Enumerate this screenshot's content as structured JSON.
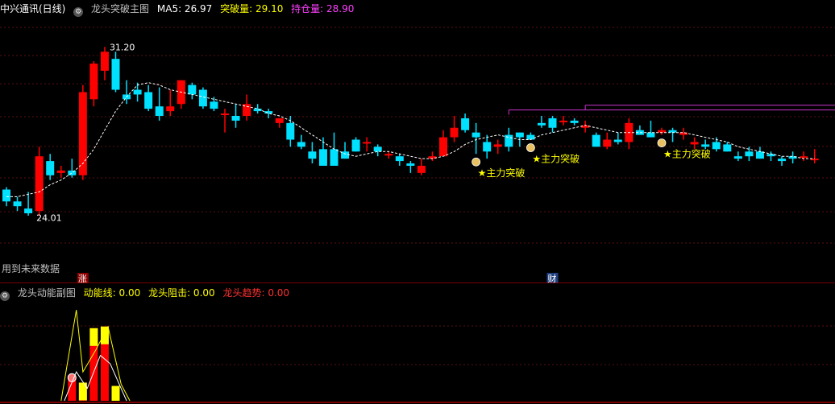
{
  "header": {
    "stock_name": "中兴通讯(日线)",
    "indicator_name": "龙头突破主图",
    "ma5_label": "MA5: 26.97",
    "breakthrough_label": "突破量: 29.10",
    "holding_label": "持仓量: 28.90"
  },
  "sub_header": {
    "indicator_name": "龙头动能副图",
    "momentum_label": "动能线: 0.00",
    "resistance_label": "龙头阻击: 0.00",
    "trend_label": "龙头趋势: 0.00"
  },
  "chart_labels": {
    "high_price": "31.20",
    "low_price": "24.01",
    "future_data_note": "用到未来数据",
    "limit_up_tag": "涨",
    "finance_tag": "财",
    "signal_text": "★主力突破"
  },
  "colors": {
    "up": "#ff0000",
    "down": "#00e0ff",
    "ma": "#ffffff",
    "stock_name": "#ffffff",
    "indicator": "#ffff00",
    "holding": "#ff40ff",
    "subtrend": "#ff3030",
    "separator": "#a00000"
  },
  "chart_data": {
    "type": "candlestick",
    "ylim": [
      22.0,
      32.5
    ],
    "high_label": 31.2,
    "low_label": 24.01,
    "ohlc": [
      [
        25.2,
        25.3,
        24.5,
        24.7
      ],
      [
        24.7,
        24.9,
        24.3,
        24.5
      ],
      [
        24.4,
        25.1,
        24.1,
        24.2
      ],
      [
        24.3,
        27.0,
        24.1,
        26.6
      ],
      [
        26.4,
        26.7,
        25.6,
        25.8
      ],
      [
        25.9,
        26.2,
        25.7,
        26.0
      ],
      [
        26.0,
        26.5,
        25.7,
        25.8
      ],
      [
        25.8,
        29.6,
        25.6,
        29.3
      ],
      [
        29.0,
        30.6,
        28.7,
        30.5
      ],
      [
        30.2,
        31.2,
        29.8,
        31.0
      ],
      [
        30.7,
        31.0,
        29.3,
        29.4
      ],
      [
        29.2,
        29.8,
        28.8,
        29.0
      ],
      [
        29.4,
        29.7,
        28.9,
        29.2
      ],
      [
        29.3,
        29.6,
        28.5,
        28.6
      ],
      [
        28.7,
        29.5,
        28.1,
        28.3
      ],
      [
        28.5,
        29.4,
        28.3,
        28.7
      ],
      [
        28.8,
        29.8,
        28.6,
        29.8
      ],
      [
        29.6,
        29.7,
        29.0,
        29.2
      ],
      [
        29.4,
        29.5,
        28.6,
        28.7
      ],
      [
        28.9,
        29.1,
        28.5,
        28.6
      ],
      [
        28.4,
        28.6,
        27.6,
        28.4
      ],
      [
        28.3,
        28.8,
        27.8,
        28.1
      ],
      [
        28.3,
        29.2,
        28.1,
        28.8
      ],
      [
        28.6,
        28.8,
        28.4,
        28.5
      ],
      [
        28.5,
        28.6,
        28.2,
        28.4
      ],
      [
        28.0,
        28.2,
        27.8,
        28.2
      ],
      [
        28.0,
        28.3,
        27.0,
        27.3
      ],
      [
        27.2,
        27.5,
        26.9,
        27.0
      ],
      [
        26.8,
        27.2,
        26.3,
        26.5
      ],
      [
        26.9,
        27.4,
        26.8,
        26.2
      ],
      [
        26.9,
        27.6,
        26.2,
        26.2
      ],
      [
        26.8,
        27.2,
        26.5,
        26.5
      ],
      [
        27.3,
        27.4,
        26.8,
        26.8
      ],
      [
        27.2,
        27.4,
        26.8,
        27.2
      ],
      [
        27.0,
        27.1,
        26.6,
        26.8
      ],
      [
        26.7,
        26.8,
        26.5,
        26.7
      ],
      [
        26.6,
        26.7,
        26.2,
        26.4
      ],
      [
        26.3,
        26.4,
        25.9,
        26.2
      ],
      [
        25.9,
        26.5,
        25.8,
        26.2
      ],
      [
        26.5,
        26.8,
        26.4,
        26.6
      ],
      [
        26.6,
        27.7,
        26.6,
        27.4
      ],
      [
        27.4,
        28.3,
        27.2,
        27.8
      ],
      [
        28.2,
        28.4,
        27.6,
        27.7
      ],
      [
        27.6,
        28.0,
        26.7,
        27.4
      ],
      [
        27.2,
        27.5,
        26.5,
        26.8
      ],
      [
        27.0,
        27.3,
        26.7,
        27.1
      ],
      [
        27.5,
        27.8,
        26.8,
        27.0
      ],
      [
        27.6,
        27.6,
        27.0,
        27.4
      ],
      [
        27.5,
        27.6,
        27.3,
        27.3
      ],
      [
        28.0,
        28.3,
        27.8,
        27.9
      ],
      [
        28.2,
        28.3,
        27.6,
        27.8
      ],
      [
        28.1,
        28.3,
        27.9,
        28.1
      ],
      [
        28.1,
        28.2,
        27.9,
        28.0
      ],
      [
        27.8,
        28.1,
        27.6,
        27.9
      ],
      [
        27.5,
        27.6,
        27.0,
        27.0
      ],
      [
        27.0,
        27.6,
        26.9,
        27.3
      ],
      [
        27.3,
        27.6,
        27.1,
        27.2
      ],
      [
        27.2,
        28.2,
        26.9,
        28.0
      ],
      [
        27.7,
        27.9,
        27.6,
        27.5
      ],
      [
        27.6,
        28.1,
        27.4,
        27.4
      ],
      [
        27.6,
        27.8,
        27.5,
        27.7
      ],
      [
        27.7,
        27.8,
        27.2,
        27.6
      ],
      [
        27.5,
        27.8,
        27.3,
        27.6
      ],
      [
        27.1,
        27.4,
        26.9,
        27.2
      ],
      [
        27.1,
        27.3,
        26.9,
        27.0
      ],
      [
        27.2,
        27.4,
        26.8,
        26.9
      ],
      [
        27.1,
        27.2,
        26.8,
        26.8
      ],
      [
        26.6,
        26.8,
        26.4,
        26.5
      ],
      [
        26.8,
        27.0,
        26.4,
        26.6
      ],
      [
        26.8,
        27.0,
        26.5,
        26.5
      ],
      [
        26.7,
        26.8,
        26.4,
        26.6
      ],
      [
        26.5,
        26.6,
        26.2,
        26.4
      ],
      [
        26.6,
        26.8,
        26.3,
        26.5
      ],
      [
        26.6,
        26.8,
        26.4,
        26.6
      ],
      [
        26.5,
        26.9,
        26.3,
        26.5
      ]
    ],
    "ma5": [
      24.9,
      24.9,
      25.0,
      25.1,
      25.4,
      25.6,
      25.9,
      26.3,
      26.9,
      27.7,
      28.5,
      29.1,
      29.6,
      29.7,
      29.6,
      29.4,
      29.3,
      29.2,
      29.1,
      29.0,
      28.9,
      28.8,
      28.7,
      28.6,
      28.4,
      28.3,
      28.1,
      27.8,
      27.5,
      27.2,
      26.9,
      26.7,
      26.6,
      26.7,
      26.8,
      26.8,
      26.7,
      26.6,
      26.5,
      26.5,
      26.6,
      26.8,
      27.1,
      27.3,
      27.4,
      27.5,
      27.4,
      27.3,
      27.3,
      27.5,
      27.6,
      27.7,
      27.8,
      27.9,
      27.8,
      27.7,
      27.6,
      27.6,
      27.6,
      27.6,
      27.6,
      27.6,
      27.6,
      27.5,
      27.4,
      27.3,
      27.2,
      27.0,
      26.9,
      26.8,
      26.7,
      26.6,
      26.6,
      26.5,
      26.5
    ],
    "resistance_lines": [
      {
        "value": 28.55,
        "from_index": 46,
        "to_index": 74
      },
      {
        "value": 28.75,
        "from_index": 53,
        "to_index": 74
      }
    ],
    "signal_indices": [
      43,
      48,
      60
    ],
    "money_bag_indices": [
      43,
      48,
      60
    ],
    "limit_up_tag_index": 7,
    "finance_tag_index": 50,
    "sub_bars": [
      {
        "index": 6,
        "value": 0.28,
        "color": "red"
      },
      {
        "index": 7,
        "value": 0.22,
        "color": "yellow"
      },
      {
        "index": 8,
        "value": 0.88,
        "color": "yellow"
      },
      {
        "index": 9,
        "value": 0.9,
        "color": "yellow"
      },
      {
        "index": 10,
        "value": 0.18,
        "color": "yellow"
      }
    ],
    "sub_ylim": [
      0,
      1.2
    ]
  }
}
